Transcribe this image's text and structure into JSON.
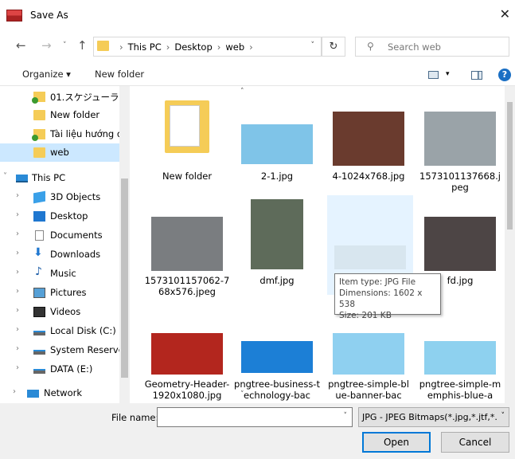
{
  "window": {
    "title": "Save As",
    "close_glyph": "✕"
  },
  "nav": {
    "back_glyph": "←",
    "forward_glyph": "→",
    "recent_glyph": "˅",
    "up_glyph": "↑",
    "breadcrumbs": [
      "This PC",
      "Desktop",
      "web"
    ],
    "crumb_sep": "›",
    "address_dropdown_glyph": "˅",
    "refresh_glyph": "↻",
    "search_placeholder": "Search web",
    "search_glyph": "⚲"
  },
  "toolbar": {
    "organize_label": "Organize ▾",
    "new_folder_label": "New folder",
    "view_dropdown_glyph": "▾",
    "help_glyph": "?"
  },
  "sidebar": {
    "chevron_right": "›",
    "chevron_down": "˅",
    "items": [
      {
        "label": "01.スケジューラ",
        "icon": "folder-sync-icon",
        "expander": "",
        "selected": false
      },
      {
        "label": "New folder",
        "icon": "folder-icon",
        "expander": "",
        "selected": false
      },
      {
        "label": "Tài liệu hướng dẫ",
        "icon": "folder-sync-icon",
        "expander": "",
        "selected": false
      },
      {
        "label": "web",
        "icon": "folder-icon",
        "expander": "",
        "selected": true
      },
      {
        "label": "This PC",
        "icon": "pc-icon",
        "expander": "˅",
        "selected": false
      },
      {
        "label": "3D Objects",
        "icon": "cube-icon",
        "expander": "›",
        "selected": false
      },
      {
        "label": "Desktop",
        "icon": "desktop-icon",
        "expander": "›",
        "selected": false
      },
      {
        "label": "Documents",
        "icon": "documents-icon",
        "expander": "›",
        "selected": false
      },
      {
        "label": "Downloads",
        "icon": "downloads-icon",
        "expander": "›",
        "selected": false
      },
      {
        "label": "Music",
        "icon": "music-icon",
        "expander": "›",
        "selected": false
      },
      {
        "label": "Pictures",
        "icon": "pictures-icon",
        "expander": "›",
        "selected": false
      },
      {
        "label": "Videos",
        "icon": "videos-icon",
        "expander": "›",
        "selected": false
      },
      {
        "label": "Local Disk (C:)",
        "icon": "disk-icon",
        "expander": "›",
        "selected": false
      },
      {
        "label": "System Reserved",
        "icon": "disk-icon",
        "expander": "›",
        "selected": false
      },
      {
        "label": "DATA (E:)",
        "icon": "disk-icon",
        "expander": "›",
        "selected": false
      },
      {
        "label": "Network",
        "icon": "network-icon",
        "expander": "›",
        "selected": false
      }
    ]
  },
  "files": [
    {
      "name": "New folder",
      "kind": "folder"
    },
    {
      "name": "2-1.jpg",
      "kind": "image",
      "color": "#7fc4e8"
    },
    {
      "name": "4-1024x768.jpg",
      "kind": "image",
      "color": "#6a3b2e"
    },
    {
      "name": "1573101137668.jpeg",
      "kind": "image",
      "color": "#9aa3a8"
    },
    {
      "name": "1573101157062-768x576.jpeg",
      "kind": "image",
      "color": "#7a7d80"
    },
    {
      "name": "dmf.jpg",
      "kind": "image",
      "color": "#5e6b5a"
    },
    {
      "name": "",
      "kind": "image",
      "color": "#d8e6ef"
    },
    {
      "name": "fd.jpg",
      "kind": "image",
      "color": "#4d4545"
    },
    {
      "name": "Geometry-Header-1920x1080.jpg",
      "kind": "image",
      "color": "#b3261e"
    },
    {
      "name": "pngtree-business-technology-bac",
      "kind": "image",
      "color": "#1c7fd6"
    },
    {
      "name": "pngtree-simple-blue-banner-bac",
      "kind": "image",
      "color": "#8fd0f0"
    },
    {
      "name": "pngtree-simple-memphis-blue-a",
      "kind": "image",
      "color": "#8ed1ef"
    }
  ],
  "tooltip": {
    "line1": "Item type: JPG File",
    "line2": "Dimensions: 1602 x 538",
    "line3": "Size: 201 KB"
  },
  "bottom": {
    "file_name_label": "File name:",
    "file_name_value": "",
    "file_name_dropdown_glyph": "˅",
    "file_type_value": "JPG - JPEG Bitmaps(*.jpg,*.jtf,*.",
    "file_type_dropdown_glyph": "˅",
    "open_label": "Open",
    "cancel_label": "Cancel"
  }
}
